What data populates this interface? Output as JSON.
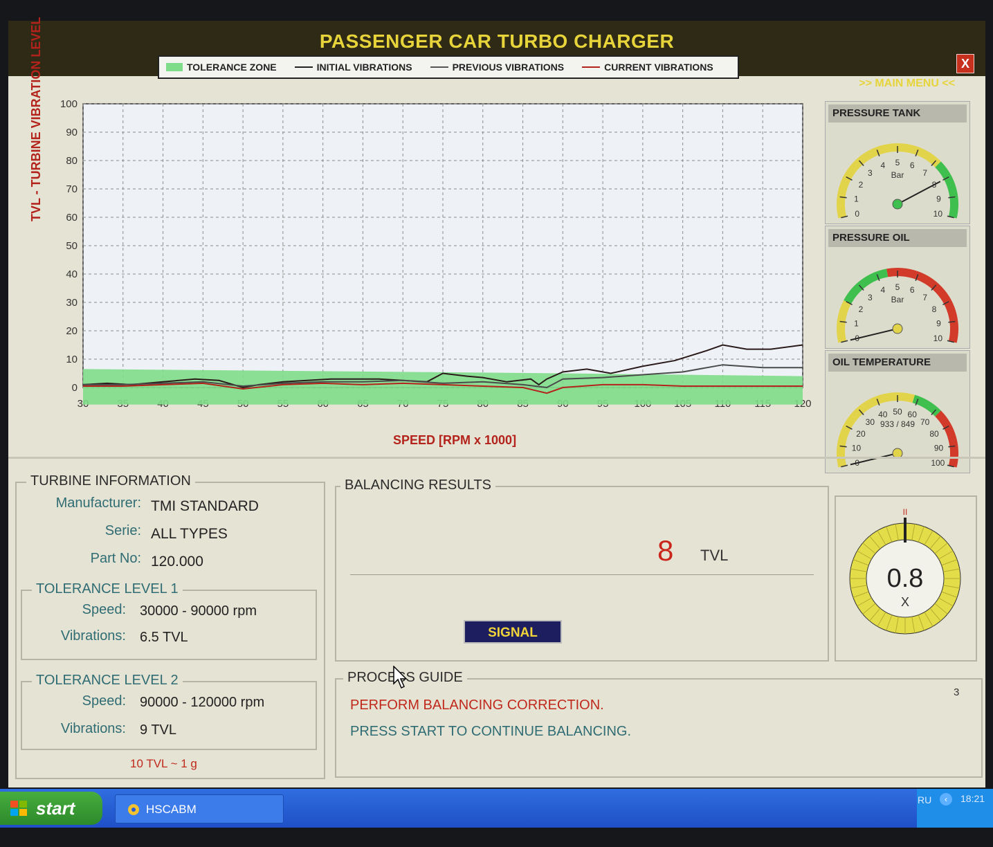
{
  "window": {
    "title": "PASSENGER CAR TURBO CHARGER",
    "main_menu": ">> MAIN  MENU <<",
    "close": "X"
  },
  "legend": {
    "tolerance_zone": "TOLERANCE ZONE",
    "initial": "INITIAL VIBRATIONS",
    "previous": "PREVIOUS VIBRATIONS",
    "current": "CURRENT VIBRATIONS"
  },
  "colors": {
    "tolerance": "#7fdd8a",
    "initial": "#2a1a1a",
    "previous": "#4a4a4a",
    "current": "#b3221b",
    "title_yellow": "#e6d43a",
    "accent_red": "#c0281c",
    "accent_teal": "#2f6c74"
  },
  "chart_data": {
    "type": "line",
    "title": "",
    "xlabel": "SPEED [RPM x 1000]",
    "ylabel": "TVL - TURBINE VIBRATION LEVEL",
    "xlim": [
      30,
      120
    ],
    "ylim": [
      0,
      100
    ],
    "x_ticks": [
      30,
      35,
      40,
      45,
      50,
      55,
      60,
      65,
      70,
      75,
      80,
      85,
      90,
      95,
      100,
      105,
      110,
      115,
      120
    ],
    "y_ticks": [
      0,
      10,
      20,
      30,
      40,
      50,
      60,
      70,
      80,
      90,
      100
    ],
    "grid": true,
    "tolerance_band": {
      "x": [
        30,
        90,
        120
      ],
      "upper": [
        6.5,
        5,
        4
      ],
      "lower": [
        -6,
        -6,
        -6
      ]
    },
    "series": [
      {
        "name": "INITIAL VIBRATIONS",
        "x": [
          30,
          33,
          36,
          40,
          44,
          47,
          50,
          52,
          55,
          58,
          61,
          64,
          67,
          70,
          73,
          75,
          78,
          80,
          83,
          86,
          87,
          88,
          90,
          93,
          96,
          100,
          104,
          108,
          110,
          113,
          116,
          120
        ],
        "y": [
          1,
          1.5,
          1,
          2,
          3,
          2.5,
          0,
          1,
          2,
          2.5,
          3,
          3,
          3,
          2.5,
          2,
          5,
          4,
          3.5,
          2,
          3,
          1,
          3,
          5.5,
          6.5,
          5,
          7.5,
          9.5,
          13,
          15,
          13.5,
          13.5,
          15
        ]
      },
      {
        "name": "PREVIOUS VIBRATIONS",
        "x": [
          30,
          35,
          40,
          45,
          50,
          55,
          60,
          65,
          70,
          75,
          80,
          85,
          88,
          90,
          95,
          100,
          105,
          110,
          115,
          120
        ],
        "y": [
          1,
          1,
          1.5,
          2,
          0.5,
          1.5,
          2,
          2,
          2.5,
          1.5,
          2,
          1,
          0,
          3,
          3.5,
          4.5,
          5.5,
          8,
          7,
          7
        ]
      },
      {
        "name": "CURRENT VIBRATIONS",
        "x": [
          30,
          35,
          40,
          45,
          50,
          55,
          60,
          65,
          70,
          75,
          80,
          85,
          88,
          90,
          95,
          100,
          105,
          110,
          115,
          120
        ],
        "y": [
          0.5,
          0.5,
          1,
          1.5,
          -0.5,
          1,
          1.5,
          1,
          1.5,
          1,
          0.5,
          0,
          -2,
          0,
          1,
          1,
          0.5,
          0.5,
          0.5,
          0.5
        ]
      }
    ]
  },
  "gauges": [
    {
      "title": "PRESSURE TANK",
      "unit": "Bar",
      "ticks": [
        "0",
        "1",
        "2",
        "3",
        "4",
        "5",
        "6",
        "7",
        "8",
        "9",
        "10"
      ],
      "value": 8
    },
    {
      "title": "PRESSURE OIL",
      "unit": "Bar",
      "ticks": [
        "0",
        "1",
        "2",
        "3",
        "4",
        "5",
        "6",
        "7",
        "8",
        "9",
        "10"
      ],
      "value": 0
    },
    {
      "title": "OIL TEMPERATURE",
      "unit": "933 / 849",
      "ticks": [
        "0",
        "10",
        "20",
        "30",
        "40",
        "50",
        "60",
        "70",
        "80",
        "90",
        "100"
      ],
      "value": 0
    }
  ],
  "turbine_info": {
    "title": "TURBINE INFORMATION",
    "manufacturer_label": "Manufacturer:",
    "manufacturer": "TMI STANDARD",
    "serie_label": "Serie:",
    "serie": "ALL TYPES",
    "part_label": "Part No:",
    "part": "120.000",
    "tol1": {
      "title": "TOLERANCE LEVEL 1",
      "speed_label": "Speed:",
      "speed": "30000 - 90000 rpm",
      "vib_label": "Vibrations:",
      "vib": "6.5 TVL"
    },
    "tol2": {
      "title": "TOLERANCE LEVEL 2",
      "speed_label": "Speed:",
      "speed": "90000 - 120000 rpm",
      "vib_label": "Vibrations:",
      "vib": "9 TVL"
    },
    "note": "10 TVL ~ 1 g"
  },
  "balancing": {
    "title": "BALANCING RESULTS",
    "value": "8",
    "unit": "TVL",
    "signal": "SIGNAL",
    "dial_value": "0.8",
    "dial_unit": "X",
    "dial_marker": "II"
  },
  "process_guide": {
    "title": "PROCESS GUIDE",
    "step": "3",
    "line1": "PERFORM BALANCING CORRECTION.",
    "line2": "PRESS START TO CONTINUE BALANCING."
  },
  "taskbar": {
    "start": "start",
    "app": "HSCABM",
    "lang": "RU",
    "clock": "18:21"
  }
}
